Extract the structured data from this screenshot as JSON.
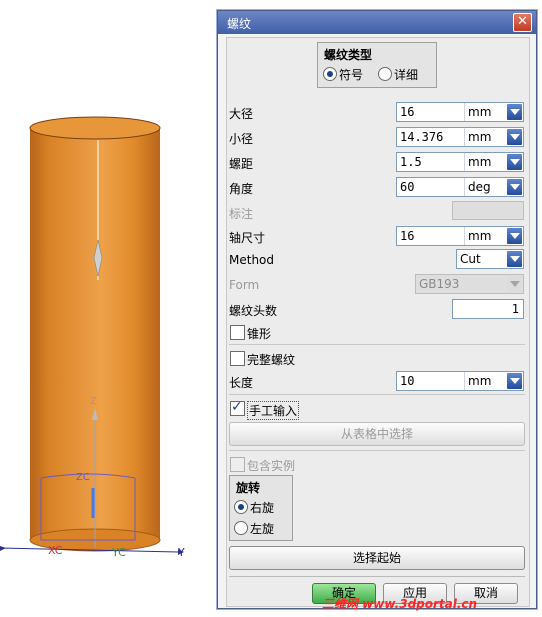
{
  "viewport": {
    "axis_z": "Z",
    "axis_zc": "ZC",
    "axis_xc": "XC",
    "axis_yc": "YC",
    "axis_y": "Y",
    "cylinder_color": "#e48a2a"
  },
  "dialog": {
    "title": "螺纹",
    "close_icon": "close-icon",
    "thread_type": {
      "title": "螺纹类型",
      "options": [
        "符号",
        "详细"
      ],
      "selected": "符号"
    },
    "params": {
      "major_diameter": {
        "label": "大径",
        "value": "16",
        "unit": "mm"
      },
      "minor_diameter": {
        "label": "小径",
        "value": "14.376",
        "unit": "mm"
      },
      "pitch": {
        "label": "螺距",
        "value": "1.5",
        "unit": "mm"
      },
      "angle": {
        "label": "角度",
        "value": "60",
        "unit": "deg"
      },
      "callout": {
        "label": "标注",
        "value": ""
      },
      "shaft_size": {
        "label": "轴尺寸",
        "value": "16",
        "unit": "mm"
      },
      "method": {
        "label": "Method",
        "value": "Cut"
      },
      "form": {
        "label": "Form",
        "value": "GB193"
      },
      "num_starts": {
        "label": "螺纹头数",
        "value": "1"
      }
    },
    "tapered": {
      "label": "锥形",
      "checked": false
    },
    "full_thread": {
      "label": "完整螺纹",
      "checked": false
    },
    "length": {
      "label": "长度",
      "value": "10",
      "unit": "mm"
    },
    "manual_input": {
      "label": "手工输入",
      "checked": true
    },
    "choose_from_table_label": "从表格中选择",
    "include_instances": {
      "label": "包含实例",
      "checked": false
    },
    "rotation": {
      "title": "旋转",
      "options": [
        "右旋",
        "左旋"
      ],
      "selected": "右旋"
    },
    "select_start_label": "选择起始",
    "ok_label": "确定",
    "apply_label": "应用",
    "cancel_label": "取消"
  },
  "watermark": "三维网 www.3dportal.cn"
}
